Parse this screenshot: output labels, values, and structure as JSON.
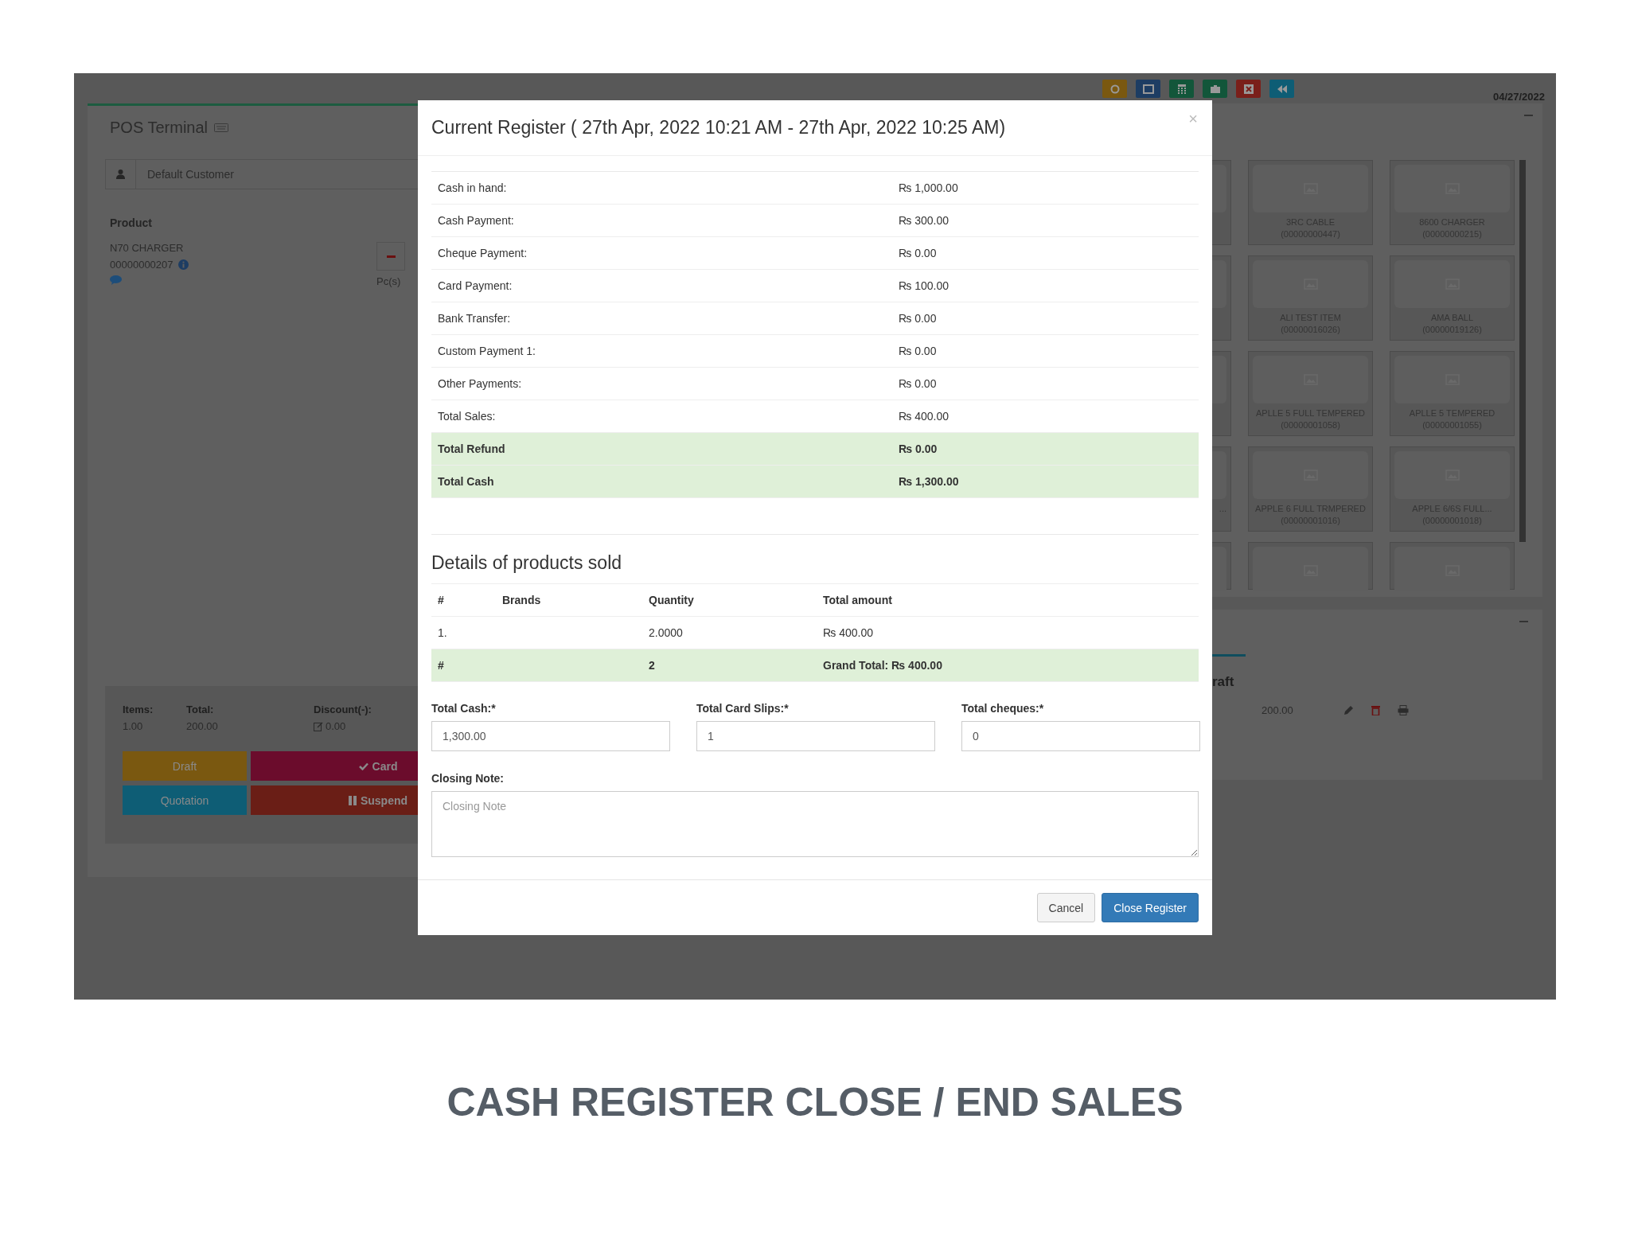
{
  "toolbar": {
    "date": "04/27/2022"
  },
  "pos_panel": {
    "title": "POS Terminal",
    "customer": "Default Customer",
    "product_heading": "Product",
    "line_item": {
      "name": "N70 CHARGER",
      "code": "00000000207",
      "unit": "Pc(s)"
    },
    "totals": [
      {
        "label": "Items:",
        "value": "1.00",
        "kind": "plain"
      },
      {
        "label": "Total:",
        "value": "200.00",
        "kind": "plain"
      },
      {
        "label": "Discount(-):",
        "value": "0.00",
        "kind": "editable"
      }
    ],
    "actions": [
      {
        "label": "Draft",
        "color": "#7a5810",
        "kind": "plain"
      },
      {
        "label": "Card",
        "color": "#6b0c2c",
        "kind": "check"
      },
      {
        "label": "Quotation",
        "color": "#0e5d75",
        "kind": "plain"
      },
      {
        "label": "Suspend",
        "color": "#6a1e16",
        "kind": "pause"
      }
    ]
  },
  "product_grid": [
    {
      "kind": "partial"
    },
    {
      "kind": "full",
      "name": "3RC CABLE",
      "code": "(00000000447)"
    },
    {
      "kind": "full",
      "name": "8600 CHARGER",
      "code": "(00000000215)"
    },
    {
      "kind": "partial"
    },
    {
      "kind": "full",
      "name": "ALI TEST ITEM",
      "code": "(00000016026)"
    },
    {
      "kind": "full",
      "name": "AMA BALL",
      "code": "(00000019126)"
    },
    {
      "kind": "partial"
    },
    {
      "kind": "full",
      "name": "APLLE 5 FULL TEMPERED",
      "code": "(00000001058)"
    },
    {
      "kind": "full",
      "name": "APLLE 5 TEMPERED",
      "code": "(00000001055)"
    },
    {
      "kind": "partial",
      "name": "..."
    },
    {
      "kind": "full",
      "name": "APPLE 6 FULL TRMPERED",
      "code": "(00000001016)"
    },
    {
      "kind": "full",
      "name": "APPLE 6/6S FULL...",
      "code": "(00000001018)"
    },
    {
      "kind": "cut"
    },
    {
      "kind": "cut"
    },
    {
      "kind": "cut"
    }
  ],
  "draft_panel": {
    "tab": "raft",
    "amount": "200.00"
  },
  "modal": {
    "title": "Current Register ( 27th Apr, 2022 10:21 AM - 27th Apr, 2022 10:25 AM)",
    "close": "×",
    "summary": [
      {
        "label": "Cash in hand:",
        "value": "₨ 1,000.00",
        "highlight": false
      },
      {
        "label": "Cash Payment:",
        "value": "₨ 300.00",
        "highlight": false
      },
      {
        "label": "Cheque Payment:",
        "value": "₨ 0.00",
        "highlight": false
      },
      {
        "label": "Card Payment:",
        "value": "₨ 100.00",
        "highlight": false
      },
      {
        "label": "Bank Transfer:",
        "value": "₨ 0.00",
        "highlight": false
      },
      {
        "label": "Custom Payment 1:",
        "value": "₨ 0.00",
        "highlight": false
      },
      {
        "label": "Other Payments:",
        "value": "₨ 0.00",
        "highlight": false
      },
      {
        "label": "Total Sales:",
        "value": "₨ 400.00",
        "highlight": false
      },
      {
        "label": "Total Refund",
        "value": "₨ 0.00",
        "highlight": true
      },
      {
        "label": "Total Cash",
        "value": "₨ 1,300.00",
        "highlight": true
      }
    ],
    "details_heading": "Details of products sold",
    "table": {
      "columns": [
        "#",
        "Brands",
        "Quantity",
        "Total amount"
      ],
      "rows": [
        {
          "index": "1.",
          "quantity": "2.0000",
          "amount": "₨ 400.00"
        }
      ],
      "footer": {
        "index": "#",
        "quantity": "2",
        "amount": "Grand Total: ₨ 400.00"
      }
    },
    "fields": [
      {
        "label": "Total Cash:*",
        "value": "1,300.00"
      },
      {
        "label": "Total Card Slips:*",
        "value": "1"
      },
      {
        "label": "Total cheques:*",
        "value": "0"
      }
    ],
    "note": {
      "label": "Closing Note:",
      "placeholder": "Closing Note"
    },
    "buttons": [
      {
        "label": "Cancel",
        "kind": "default"
      },
      {
        "label": "Close Register",
        "kind": "primary"
      }
    ]
  },
  "caption": "CASH REGISTER CLOSE / END SALES"
}
